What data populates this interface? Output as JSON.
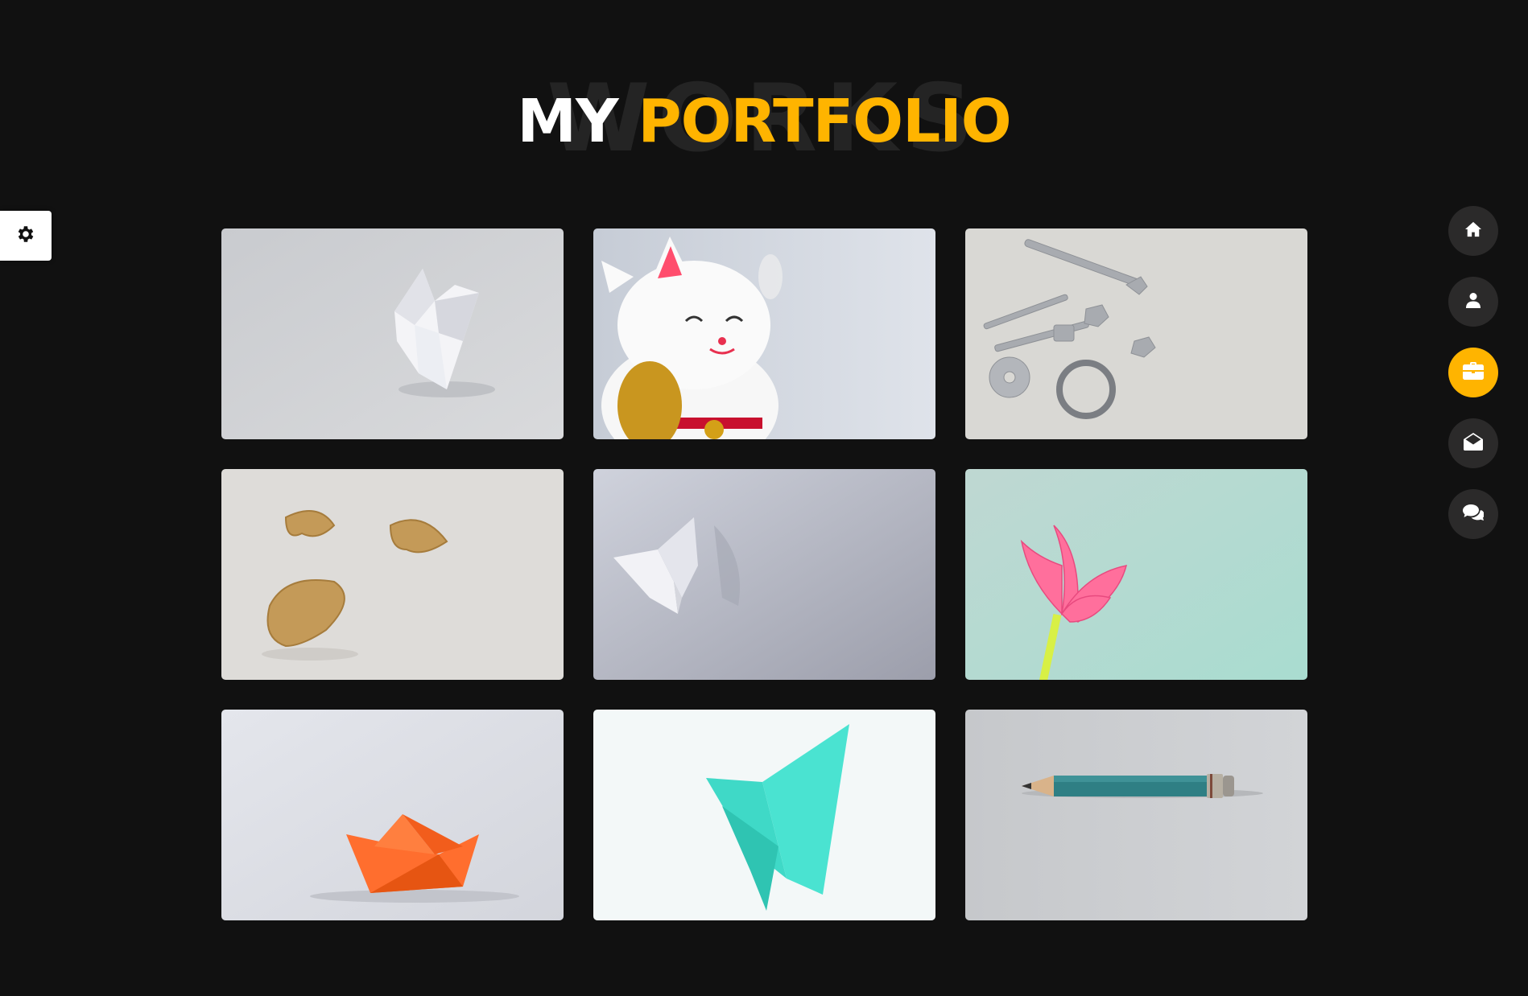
{
  "heading": {
    "background_word": "WORKS",
    "title_white": "MY",
    "title_accent": "PORTFOLIO"
  },
  "colors": {
    "background": "#111111",
    "accent": "#ffb400",
    "nav_button": "#2b2a2a"
  },
  "settings": {
    "icon": "gear-icon"
  },
  "nav": {
    "items": [
      {
        "id": "home",
        "icon": "home-icon",
        "active": false
      },
      {
        "id": "about",
        "icon": "user-icon",
        "active": false
      },
      {
        "id": "portfolio",
        "icon": "briefcase-icon",
        "active": true
      },
      {
        "id": "contact",
        "icon": "envelope-open-icon",
        "active": false
      },
      {
        "id": "blog",
        "icon": "comments-icon",
        "active": false
      }
    ]
  },
  "portfolio": {
    "items": [
      {
        "subject": "white paper origami fortune teller"
      },
      {
        "subject": "lucky cat figurine"
      },
      {
        "subject": "wrench, bolts, nuts and washers"
      },
      {
        "subject": "fortune cookies"
      },
      {
        "subject": "white paper butterfly"
      },
      {
        "subject": "pink origami lily"
      },
      {
        "subject": "orange paper boat"
      },
      {
        "subject": "turquoise origami butterfly"
      },
      {
        "subject": "short pencil"
      }
    ]
  }
}
